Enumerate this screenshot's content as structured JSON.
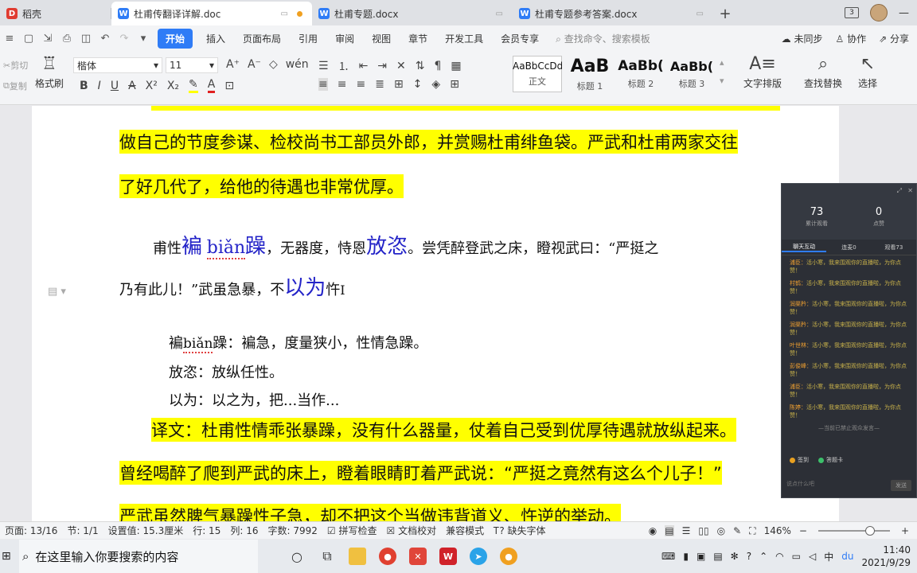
{
  "tabs": [
    {
      "label": "稻壳",
      "icon": "daoke-icon",
      "color": "#e03c31"
    },
    {
      "label": "杜甫传翻译详解.doc",
      "icon": "wps-doc-icon",
      "color": "#2f7cf6"
    },
    {
      "label": "杜甫专题.docx",
      "icon": "wps-doc-icon",
      "color": "#2f7cf6"
    },
    {
      "label": "杜甫专题参考答案.docx",
      "icon": "wps-doc-icon",
      "color": "#2f7cf6"
    }
  ],
  "new_tab": "+",
  "tab_counter": "3",
  "menu": {
    "items": [
      "开始",
      "插入",
      "页面布局",
      "引用",
      "审阅",
      "视图",
      "章节",
      "开发工具",
      "会员专享"
    ],
    "search_placeholder": "查找命令、搜索模板",
    "right": [
      "未同步",
      "协作",
      "分享"
    ]
  },
  "ribbon": {
    "cut": "剪切",
    "copy": "复制",
    "format_painter": "格式刷",
    "font_name": "楷体",
    "font_size": "11",
    "styles": [
      {
        "sample": "AaBbCcDd",
        "name": "正文"
      },
      {
        "sample": "AaB",
        "name": "标题 1"
      },
      {
        "sample": "AaBb(",
        "name": "标题 2"
      },
      {
        "sample": "AaBb(",
        "name": "标题 3"
      }
    ],
    "text_layout": "文字排版",
    "find_replace": "查找替换",
    "select": "选择"
  },
  "doc": {
    "line1": "做自己的节度参谋、检校尚书工部员外郎，并赏赐杜甫绯鱼袋。严武和杜甫两家交往",
    "line2": "了好几代了，给他的待遇也非常优厚。",
    "orig_a": "甫性",
    "orig_b": "褊",
    "orig_c": "biǎn",
    "orig_d": "躁",
    "orig_e": "，无器度，恃恩",
    "orig_f": "放恣",
    "orig_g": "。尝凭醉登武之床，瞪视武曰：“严挺之",
    "orig2_a": "乃有此儿！”武虽急暴，不",
    "orig2_b": "以为",
    "orig2_c": "忤",
    "note1_a": "褊",
    "note1_b": "biǎn",
    "note1_c": "躁：褊急，度量狭小，性情急躁。",
    "note2": "放恣：放纵任性。",
    "note3": "以为：以之为，把...当作...",
    "trans1": "译文：杜甫性情乖张暴躁，没有什么器量，仗着自己受到优厚待遇就放纵起来。",
    "trans2": "曾经喝醉了爬到严武的床上，瞪着眼睛盯着严武说：“严挺之竟然有这么个儿子！”",
    "trans3": "严武虽然脾气暴躁性子急，却不把这个当做违背道义、忤逆的举动。"
  },
  "live": {
    "stat1_num": "73",
    "stat1_label": "累计观看",
    "stat2_num": "0",
    "stat2_label": "点赞",
    "tabs": [
      "聊天互动",
      "连麦0",
      "观看73"
    ],
    "messages": [
      {
        "who": "浦臣：",
        "text": "活小寒，我来围观你的直播啦，为你点赞！"
      },
      {
        "who": "村鹤：",
        "text": "活小寒，我来围观你的直播啦，为你点赞！"
      },
      {
        "who": "润渠矜：",
        "text": "活小寒，我来围观你的直播啦，为你点赞！"
      },
      {
        "who": "润渠矜：",
        "text": "活小寒，我来围观你的直播啦，为你点赞！"
      },
      {
        "who": "叶世林：",
        "text": "活小寒，我来围观你的直播啦，为你点赞！"
      },
      {
        "who": "彭俊峰：",
        "text": "活小寒，我来围观你的直播啦，为你点赞！"
      },
      {
        "who": "浦臣：",
        "text": "活小寒，我来围观你的直播啦，为你点赞！"
      },
      {
        "who": "陈婷：",
        "text": "活小寒，我来围观你的直播啦，为你点赞！"
      }
    ],
    "separator": "—当前已禁止观众发言—",
    "action1": "签到",
    "action2": "答题卡",
    "input_placeholder": "说点什么吧",
    "send": "发送"
  },
  "status": {
    "page": "页面: 13/16",
    "section": "节: 1/1",
    "setting": "设置值: 15.3厘米",
    "row": "行: 15",
    "col": "列: 16",
    "words": "字数: 7992",
    "spell": "拼写检查",
    "proof": "文档校对",
    "compat": "兼容模式",
    "missing_font": "缺失字体",
    "zoom": "146%",
    "zoom_level": 0.72
  },
  "taskbar": {
    "search_placeholder": "在这里输入你要搜索的内容",
    "time": "11:40",
    "date": "2021/9/29"
  }
}
